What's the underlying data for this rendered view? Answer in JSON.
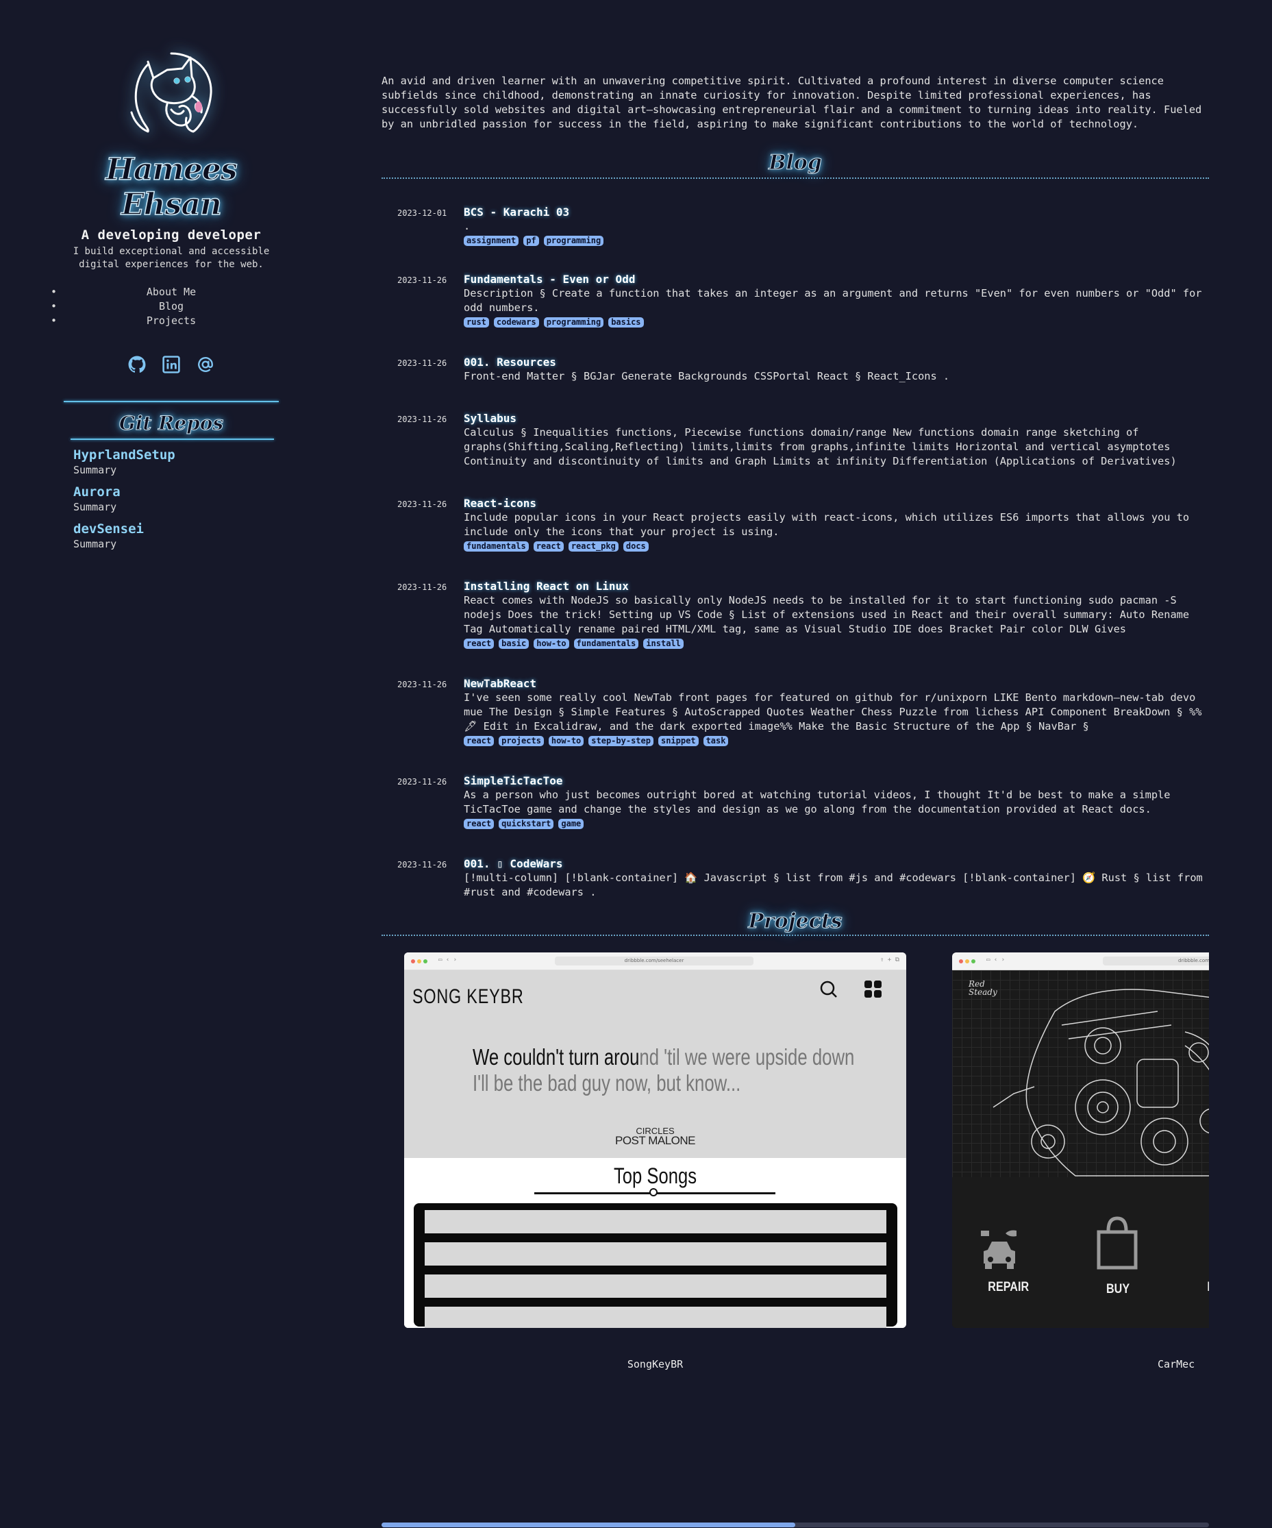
{
  "profile": {
    "name": "Hamees Ehsan",
    "tagline": "A developing developer",
    "intro": "I build exceptional and accessible digital experiences for the web."
  },
  "nav": {
    "items": [
      "About Me",
      "Blog",
      "Projects"
    ]
  },
  "socials": [
    {
      "icon": "github-icon"
    },
    {
      "icon": "linkedin-icon"
    },
    {
      "icon": "at-sign-icon"
    }
  ],
  "repos": {
    "title": "Git Repos",
    "items": [
      {
        "name": "HyprlandSetup",
        "summary": "Summary"
      },
      {
        "name": "Aurora",
        "summary": "Summary"
      },
      {
        "name": "devSensei",
        "summary": "Summary"
      }
    ]
  },
  "bio": "An avid and driven learner with an unwavering competitive spirit. Cultivated a profound interest in diverse computer science subfields since childhood, demonstrating an innate curiosity for innovation. Despite limited professional experiences, has successfully sold websites and digital art—showcasing entrepreneurial flair and a commitment to turning ideas into reality. Fueled by an unbridled passion for success in the field, aspiring to make significant contributions to the world of technology.",
  "blog": {
    "title": "Blog",
    "posts": [
      {
        "date": "2023-12-01",
        "title": "BCS - Karachi 03",
        "excerpt": ".",
        "tags": [
          "assignment",
          "pf",
          "programming"
        ]
      },
      {
        "date": "2023-11-26",
        "title": "Fundamentals - Even or Odd",
        "excerpt": "Description § Create a function that takes an integer as an argument and returns \"Even\" for even numbers or \"Odd\" for odd numbers.",
        "tags": [
          "rust",
          "codewars",
          "programming",
          "basics"
        ]
      },
      {
        "date": "2023-11-26",
        "title": "001. Resources",
        "excerpt": "Front-end Matter § BGJar Generate Backgrounds CSSPortal React § React_Icons .",
        "tags": []
      },
      {
        "date": "2023-11-26",
        "title": "Syllabus",
        "excerpt": "Calculus § Inequalities functions, Piecewise functions domain/range New functions domain range sketching of graphs(Shifting,Scaling,Reflecting) limits,limits from graphs,infinite limits Horizontal and vertical asymptotes Continuity and discontinuity of limits and Graph Limits at infinity Differentiation (Applications of Derivatives)",
        "tags": []
      },
      {
        "date": "2023-11-26",
        "title": "React-icons",
        "excerpt": "Include popular icons in your React projects easily with react-icons, which utilizes ES6 imports that allows you to include only the icons that your project is using.",
        "tags": [
          "fundamentals",
          "react",
          "react_pkg",
          "docs"
        ]
      },
      {
        "date": "2023-11-26",
        "title": "Installing React on Linux",
        "excerpt": "React comes with NodeJS so basically only NodeJS needs to be installed for it to start functioning sudo pacman -S nodejs Does the trick! Setting up VS Code § List of extensions used in React and their overall summary: Auto Rename Tag Automatically rename paired HTML/XML tag, same as Visual Studio IDE does Bracket Pair color DLW Gives",
        "tags": [
          "react",
          "basic",
          "how-to",
          "fundamentals",
          "install"
        ]
      },
      {
        "date": "2023-11-26",
        "title": "NewTabReact",
        "excerpt": "I've seen some really cool NewTab front pages for featured on github for r/unixporn LIKE Bento markdown—new-tab devo mue The Design § Simple Features § AutoScrapped Quotes Weather Chess Puzzle from lichess API Component BreakDown § %%🖋 Edit in Excalidraw, and the dark exported image%% Make the Basic Structure of the App § NavBar §",
        "tags": [
          "react",
          "projects",
          "how-to",
          "step-by-step",
          "snippet",
          "task"
        ]
      },
      {
        "date": "2023-11-26",
        "title": "SimpleTicTacToe",
        "excerpt": "As a person who just becomes outright bored at watching tutorial videos, I thought It'd be best to make a simple TicTacToe game and change the styles and design as we go along from the documentation provided at React docs.",
        "tags": [
          "react",
          "quickstart",
          "game"
        ]
      },
      {
        "date": "2023-11-26",
        "title": "001. ▯ CodeWars",
        "excerpt": "[!multi-column] [!blank-container] 🏠 Javascript § list from #js and #codewars [!blank-container] 🧭 Rust § list from #rust and #codewars .",
        "tags": []
      }
    ]
  },
  "projects": {
    "title": "Projects",
    "items": [
      {
        "label": "SongKeyBR",
        "url": "dribbble.com/seehelacer",
        "screenshot": {
          "logo": "SONG KEYBR",
          "lyric_dark": "We couldn't turn arou",
          "lyric_light": "nd 'til we were upside down",
          "lyric_line2": "I'll be the bad guy now, but know...",
          "song": "CIRCLES",
          "artist": "POST MALONE",
          "top_songs": "Top Songs"
        }
      },
      {
        "label": "CarMec",
        "url": "dribbble.com",
        "screenshot": {
          "brand": "Red Steady",
          "repair": "REPAIR",
          "buy": "BUY",
          "cut": "I"
        }
      }
    ],
    "scroll_progress": 0.5
  },
  "colors": {
    "background": "#161829",
    "accent": "#64c2ea",
    "tag_bg": "#89b4f4",
    "repo_link": "#8fd3f5"
  }
}
